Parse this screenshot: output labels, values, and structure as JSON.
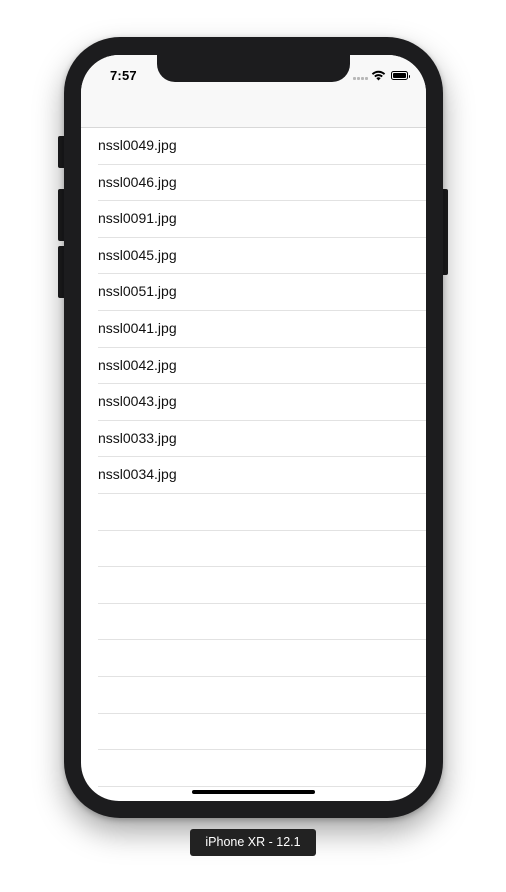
{
  "status_bar": {
    "time": "7:57"
  },
  "file_list": {
    "items": [
      "nssl0049.jpg",
      "nssl0046.jpg",
      "nssl0091.jpg",
      "nssl0045.jpg",
      "nssl0051.jpg",
      "nssl0041.jpg",
      "nssl0042.jpg",
      "nssl0043.jpg",
      "nssl0033.jpg",
      "nssl0034.jpg"
    ],
    "empty_rows": 8
  },
  "simulator": {
    "device_label": "iPhone XR - 12.1"
  },
  "icons": {
    "wifi": "wifi-icon",
    "battery": "battery-icon",
    "signal": "cellular-signal-icon"
  },
  "colors": {
    "frame": "#1c1c1e",
    "nav_background": "#f8f8f8",
    "separator": "#e2e2e2",
    "label_background": "#222222"
  }
}
